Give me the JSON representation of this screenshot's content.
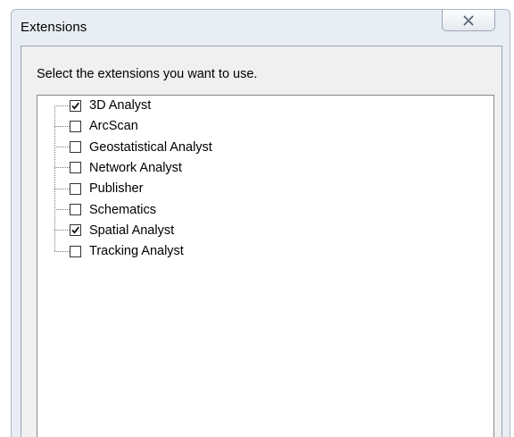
{
  "window": {
    "title": "Extensions",
    "close_icon": "close-icon"
  },
  "dialog": {
    "instruction": "Select the extensions you want to use."
  },
  "extensions": [
    {
      "label": "3D Analyst",
      "checked": true
    },
    {
      "label": "ArcScan",
      "checked": false
    },
    {
      "label": "Geostatistical Analyst",
      "checked": false
    },
    {
      "label": "Network Analyst",
      "checked": false
    },
    {
      "label": "Publisher",
      "checked": false
    },
    {
      "label": "Schematics",
      "checked": false
    },
    {
      "label": "Spatial Analyst",
      "checked": true
    },
    {
      "label": "Tracking Analyst",
      "checked": false
    }
  ],
  "colors": {
    "window_frame": "#e9eef5",
    "client_background": "#f0f0f0",
    "list_background": "#ffffff"
  }
}
